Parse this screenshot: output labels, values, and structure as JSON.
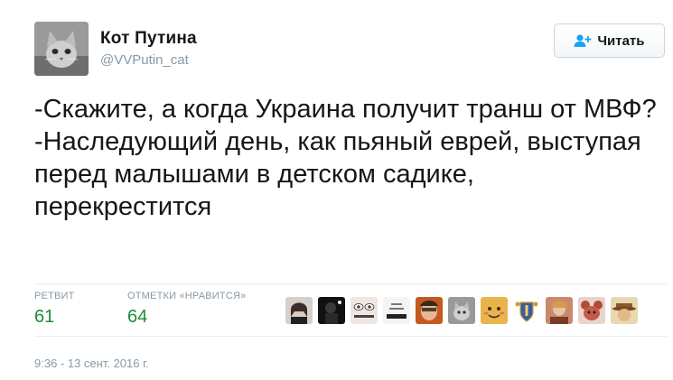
{
  "author": {
    "name": "Кот Путина",
    "handle": "@VVPutin_cat",
    "avatar_icon": "cat-avatar-icon"
  },
  "follow_button": {
    "label": "Читать",
    "icon": "add-user-icon",
    "icon_color": "#1da1f2"
  },
  "tweet": {
    "text": "-Скажите, а когда Украина получит транш от МВФ?\n-Наследующий день, как пьяный еврей, выступая перед малышами в детском садике, перекрестится"
  },
  "stats": {
    "retweets_label": "РЕТВИТ",
    "retweets_count": "61",
    "likes_label": "ОТМЕТКИ «НРАВИТСЯ»",
    "likes_count": "64",
    "count_color": "#1b8c3a"
  },
  "likers": [
    {
      "icon": "woman-avatar-icon",
      "tone": "#6b5a52"
    },
    {
      "icon": "dark-avatar-icon",
      "tone": "#1c1c1c"
    },
    {
      "icon": "eyes-avatar-icon",
      "tone": "#d9c7c0"
    },
    {
      "icon": "text-avatar-icon",
      "tone": "#e8e8e8"
    },
    {
      "icon": "face-avatar-icon",
      "tone": "#c45a1f"
    },
    {
      "icon": "cat-avatar-icon",
      "tone": "#8a8a8a"
    },
    {
      "icon": "emoji-avatar-icon",
      "tone": "#e0a23a"
    },
    {
      "icon": "crest-avatar-icon",
      "tone": "#3b5aa8"
    },
    {
      "icon": "painting-avatar-icon",
      "tone": "#c98a6a"
    },
    {
      "icon": "mouse-avatar-icon",
      "tone": "#b04a3a"
    },
    {
      "icon": "hat-avatar-icon",
      "tone": "#c9a76a"
    }
  ],
  "timestamp": "9:36 - 13 сент. 2016 г."
}
